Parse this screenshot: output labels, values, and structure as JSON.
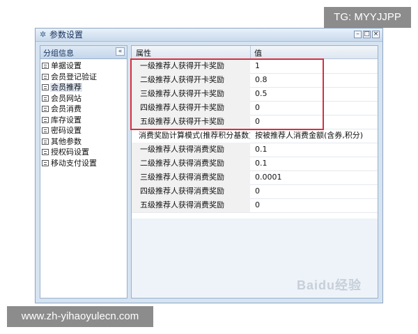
{
  "overlay_tag": "TG: MYYJJPP",
  "window": {
    "title": "参数设置",
    "buttons": {
      "minimize": "–",
      "maximize": "□",
      "close": "×"
    }
  },
  "left_panel": {
    "header": "分组信息",
    "collapse_symbol": "«",
    "items": [
      {
        "label": "单据设置"
      },
      {
        "label": "会员登记验证"
      },
      {
        "label": "会员推荐"
      },
      {
        "label": "会员网站"
      },
      {
        "label": "会员消费"
      },
      {
        "label": "库存设置"
      },
      {
        "label": "密码设置"
      },
      {
        "label": "其他参数"
      },
      {
        "label": "授权码设置"
      },
      {
        "label": "移动支付设置"
      }
    ],
    "selected_index": 2
  },
  "grid": {
    "headers": {
      "property": "属性",
      "value": "值"
    },
    "rows": [
      {
        "property": "一级推荐人获得开卡奖励",
        "value": "1"
      },
      {
        "property": "二级推荐人获得开卡奖励",
        "value": "0.8"
      },
      {
        "property": "三级推荐人获得开卡奖励",
        "value": "0.5"
      },
      {
        "property": "四级推荐人获得开卡奖励",
        "value": "0"
      },
      {
        "property": "五级推荐人获得开卡奖励",
        "value": "0"
      },
      {
        "property": "消费奖励计算模式(推荐积分基数)",
        "value": "按被推荐人消费金额(含券,积分)"
      },
      {
        "property": "一级推荐人获得消费奖励",
        "value": "0.1"
      },
      {
        "property": "二级推荐人获得消费奖励",
        "value": "0.1"
      },
      {
        "property": "三级推荐人获得消费奖励",
        "value": "0.0001"
      },
      {
        "property": "四级推荐人获得消费奖励",
        "value": "0"
      },
      {
        "property": "五级推荐人获得消费奖励",
        "value": "0"
      }
    ]
  },
  "watermark": "Baidu经验",
  "footer_url": "www.zh-yihaoyulecn.com",
  "colors": {
    "highlight_border": "#d82e3c",
    "window_bg": "#d6e3f1"
  }
}
